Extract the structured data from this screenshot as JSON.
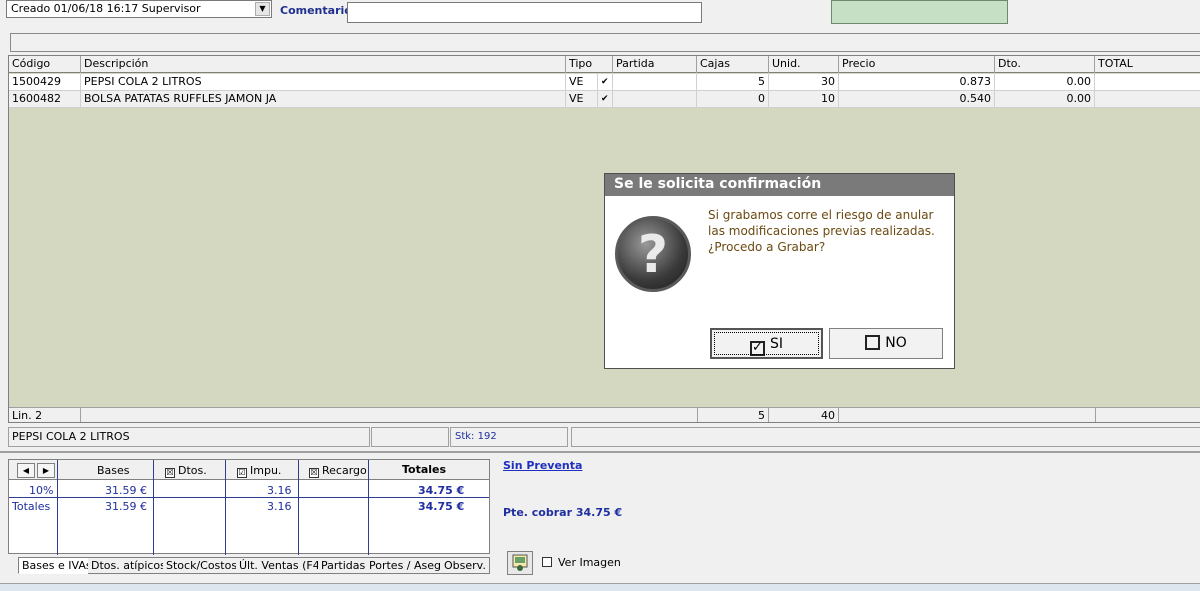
{
  "top": {
    "combo_value": "Creado 01/06/18 16:17 Supervisor",
    "comentario_label": "Comentario",
    "comentario_value": ""
  },
  "grid": {
    "columns": [
      "Código",
      "Descripción",
      "Tipo",
      "Partida",
      "Cajas",
      "Unid.",
      "Precio",
      "Dto.",
      "TOTAL"
    ],
    "rows": [
      {
        "codigo": "1500429",
        "descripcion": "PEPSI COLA 2 LITROS",
        "tipo": "VE",
        "check": "✔",
        "partida": "",
        "cajas": "5",
        "unid": "30",
        "precio": "0.873",
        "dto": "0.00",
        "total": ""
      },
      {
        "codigo": "1600482",
        "descripcion": "BOLSA PATATAS RUFFLES JAMON JA",
        "tipo": "VE",
        "check": "✔",
        "partida": "",
        "cajas": "0",
        "unid": "10",
        "precio": "0.540",
        "dto": "0.00",
        "total": ""
      }
    ],
    "footer": {
      "lin": "Lin. 2",
      "cajas": "5",
      "unid": "40"
    }
  },
  "status": {
    "product": "PEPSI COLA 2 LITROS",
    "stock": "Stk: 192"
  },
  "bases": {
    "headers": {
      "bases": "Bases",
      "dtos": "Dtos.",
      "impu": "Impu.",
      "recargo": "Recargo",
      "totales": "Totales"
    },
    "checks": {
      "dtos": "☒",
      "impu": "☑",
      "recargo": "☒"
    },
    "rows": [
      {
        "label": "10%",
        "bases": "31.59 €",
        "impu": "3.16",
        "totales": "34.75 €"
      },
      {
        "label": "Totales",
        "bases": "31.59 €",
        "impu": "3.16",
        "totales": "34.75 €"
      }
    ]
  },
  "tabs": [
    "Bases e IVAs",
    "Dtos. atípicos",
    "Stock/Costos",
    "Últ. Ventas (F4)",
    "Partidas",
    "Portes / Aseg.",
    "Observ."
  ],
  "right_panel": {
    "sin_preventa": "Sin Preventa",
    "pte_cobrar": "Pte. cobrar 34.75 €",
    "ver_imagen": "Ver Imagen"
  },
  "dialog": {
    "title": "Se le solicita confirmación",
    "message_line1": "Si grabamos corre el riesgo de anular",
    "message_line2": "las modificaciones previas realizadas.",
    "message_line3": "¿Procedo a Grabar?",
    "icon_glyph": "?",
    "yes_label": "SI",
    "no_label": "NO",
    "yes_check": "✓"
  },
  "colors": {
    "grid_bg": "#d4d8c1",
    "accent_blue": "#1f2f9f",
    "green_box": "#c5e0c5",
    "dialog_title_bg": "#7a7a7a",
    "dialog_text": "#6b4a12"
  }
}
